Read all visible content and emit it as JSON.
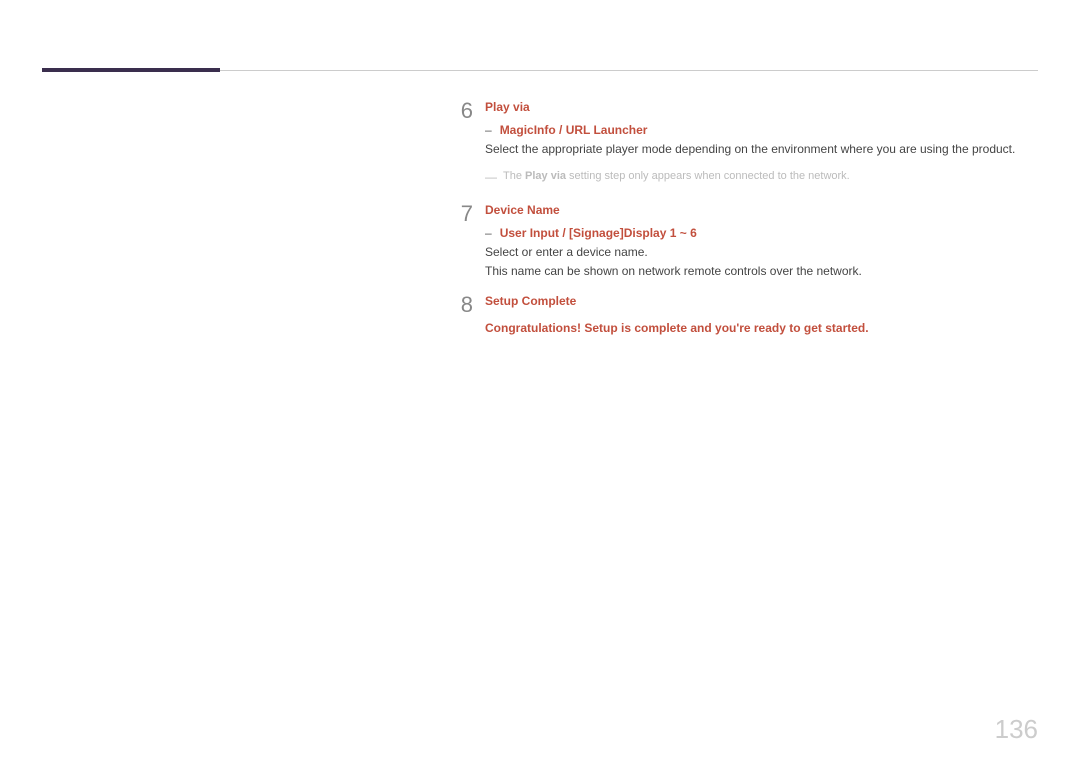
{
  "page_number": "136",
  "steps": [
    {
      "number": "6",
      "title": "Play via",
      "sub_option": "MagicInfo / URL Launcher",
      "body": "Select the appropriate player mode depending on the environment where you are using the product.",
      "note_prefix": "The ",
      "note_bold": "Play via",
      "note_suffix": " setting step only appears when connected to the network."
    },
    {
      "number": "7",
      "title": "Device Name",
      "sub_option": "User Input / [Signage]Display 1 ~ 6",
      "body_line1": "Select or enter a device name.",
      "body_line2": "This name can be shown on network remote controls over the network."
    },
    {
      "number": "8",
      "title": "Setup Complete",
      "congrats": "Congratulations! Setup is complete and you're ready to get started."
    }
  ]
}
